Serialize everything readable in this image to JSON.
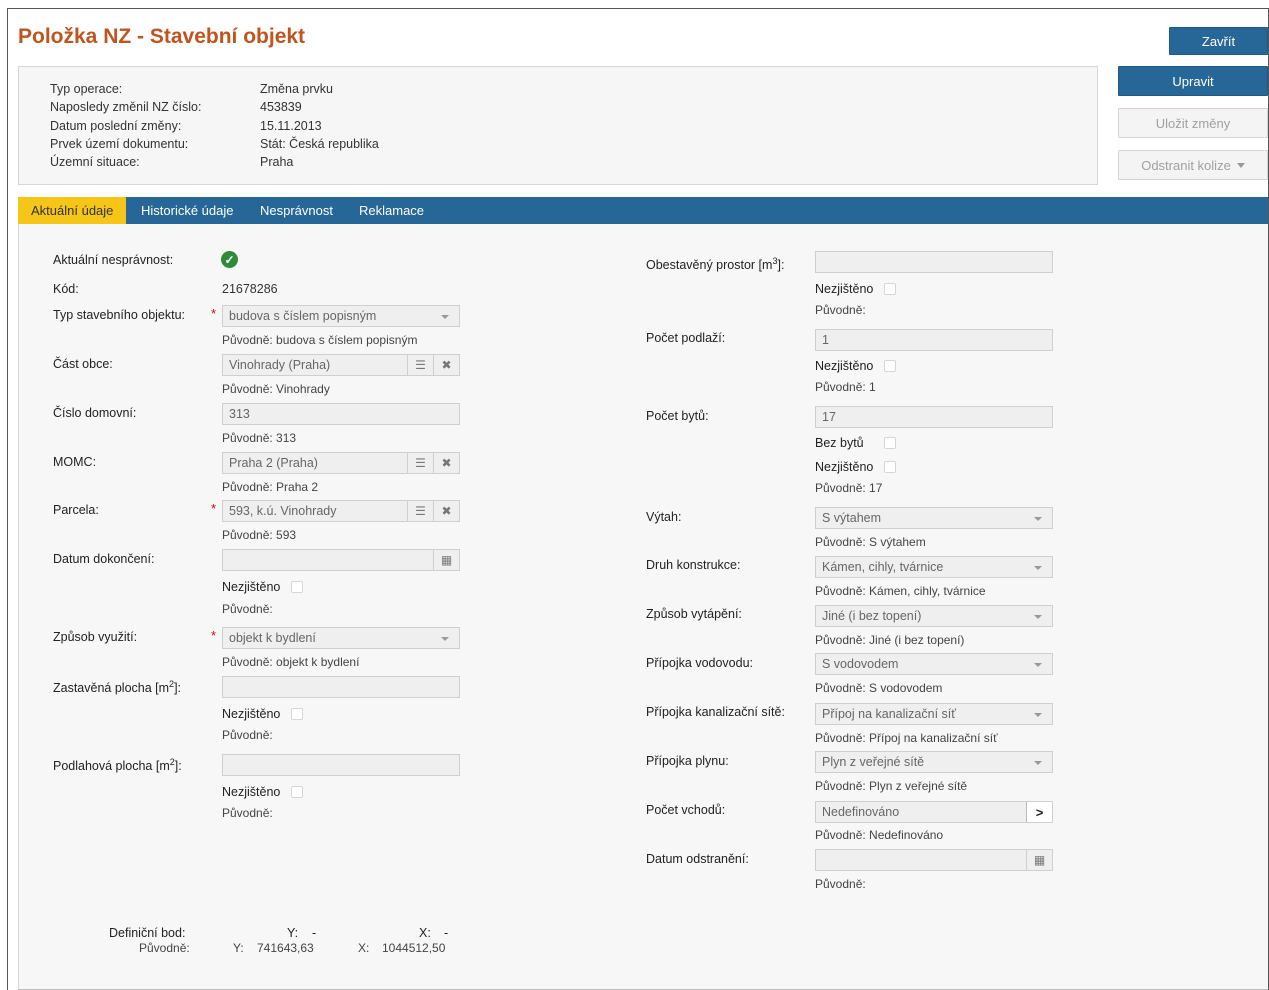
{
  "page_title": "Položka NZ - Stavební objekt",
  "buttons": {
    "close": "Zavřít",
    "edit": "Upravit",
    "save": "Uložit změny",
    "remove_conflicts": "Odstranit kolize"
  },
  "info": {
    "rows": [
      {
        "label": "Typ operace:",
        "value": "Změna prvku"
      },
      {
        "label": "Naposledy změnil NZ číslo:",
        "value": "453839"
      },
      {
        "label": "Datum poslední změny:",
        "value": "15.11.2013"
      },
      {
        "label": "Prvek území dokumentu:",
        "value": "Stát: Česká republika"
      },
      {
        "label": "Územní situace:",
        "value": "Praha"
      }
    ]
  },
  "tabs": [
    "Aktuální údaje",
    "Historické údaje",
    "Nesprávnost",
    "Reklamace"
  ],
  "left": {
    "nespravnost_label": "Aktuální nesprávnost:",
    "kod_label": "Kód:",
    "kod_value": "21678286",
    "typ_label": "Typ stavebního objektu:",
    "typ_value": "budova s číslem popisným",
    "typ_orig": "Původně: budova s číslem popisným",
    "cast_label": "Část obce:",
    "cast_value": "Vinohrady (Praha)",
    "cast_orig": "Původně: Vinohrady",
    "cislo_label": "Číslo domovní:",
    "cislo_value": "313",
    "cislo_orig": "Původně: 313",
    "momc_label": "MOMC:",
    "momc_value": "Praha 2 (Praha)",
    "momc_orig": "Původně: Praha 2",
    "parcela_label": "Parcela:",
    "parcela_value": "593, k.ú. Vinohrady",
    "parcela_orig": "Původně: 593",
    "datum_dok_label": "Datum dokončení:",
    "datum_dok_nezjisteno": "Nezjištěno",
    "datum_dok_orig": "Původně:",
    "zpusob_label": "Způsob využití:",
    "zpusob_value": "objekt k bydlení",
    "zpusob_orig": "Původně: objekt k bydlení",
    "zastavena_label_pre": "Zastavěná plocha [m",
    "zastavena_label_sup": "2",
    "zastavena_label_post": "]:",
    "zastavena_nezjisteno": "Nezjištěno",
    "zastavena_orig": "Původně:",
    "podlahova_label_pre": "Podlahová plocha [m",
    "podlahova_label_sup": "2",
    "podlahova_label_post": "]:",
    "podlahova_nezjisteno": "Nezjištěno",
    "podlahova_orig": "Původně:",
    "defbod_label": "Definiční bod:",
    "defbod_y_label": "Y:",
    "defbod_y_value": "-",
    "defbod_x_label": "X:",
    "defbod_x_value": "-",
    "defbod_orig_label": "Původně:",
    "defbod_orig_y_label": "Y:",
    "defbod_orig_y_value": "741643,63",
    "defbod_orig_x_label": "X:",
    "defbod_orig_x_value": "1044512,50"
  },
  "right": {
    "obestaveny_label_pre": "Obestavěný prostor [m",
    "obestaveny_label_sup": "3",
    "obestaveny_label_post": "]:",
    "obestaveny_nezjisteno": "Nezjištěno",
    "obestaveny_orig": "Původně:",
    "podlazi_label": "Počet podlaží:",
    "podlazi_value": "1",
    "podlazi_nezjisteno": "Nezjištěno",
    "podlazi_orig": "Původně: 1",
    "byty_label": "Počet bytů:",
    "byty_value": "17",
    "byty_bez": "Bez bytů",
    "byty_nezjisteno": "Nezjištěno",
    "byty_orig": "Původně: 17",
    "vytah_label": "Výtah:",
    "vytah_value": "S výtahem",
    "vytah_orig": "Původně: S výtahem",
    "druh_label": "Druh konstrukce:",
    "druh_value": "Kámen, cihly, tvárnice",
    "druh_orig": "Původně: Kámen, cihly, tvárnice",
    "vytapeni_label": "Způsob vytápění:",
    "vytapeni_value": "Jiné (i bez topení)",
    "vytapeni_orig": "Původně: Jiné (i bez topení)",
    "vodovod_label": "Přípojka vodovodu:",
    "vodovod_value": "S vodovodem",
    "vodovod_orig": "Původně: S vodovodem",
    "kanal_label": "Přípojka kanalizační sítě:",
    "kanal_value": "Přípoj na kanalizační síť",
    "kanal_orig": "Původně: Přípoj na kanalizační síť",
    "plyn_label": "Přípojka plynu:",
    "plyn_value": "Plyn z veřejné sítě",
    "plyn_orig": "Původně: Plyn z veřejné sítě",
    "vchody_label": "Počet vchodů:",
    "vchody_value": "Nedefinováno",
    "vchody_orig": "Původně: Nedefinováno",
    "odstraneni_label": "Datum odstranění:",
    "odstraneni_orig": "Původně:"
  }
}
